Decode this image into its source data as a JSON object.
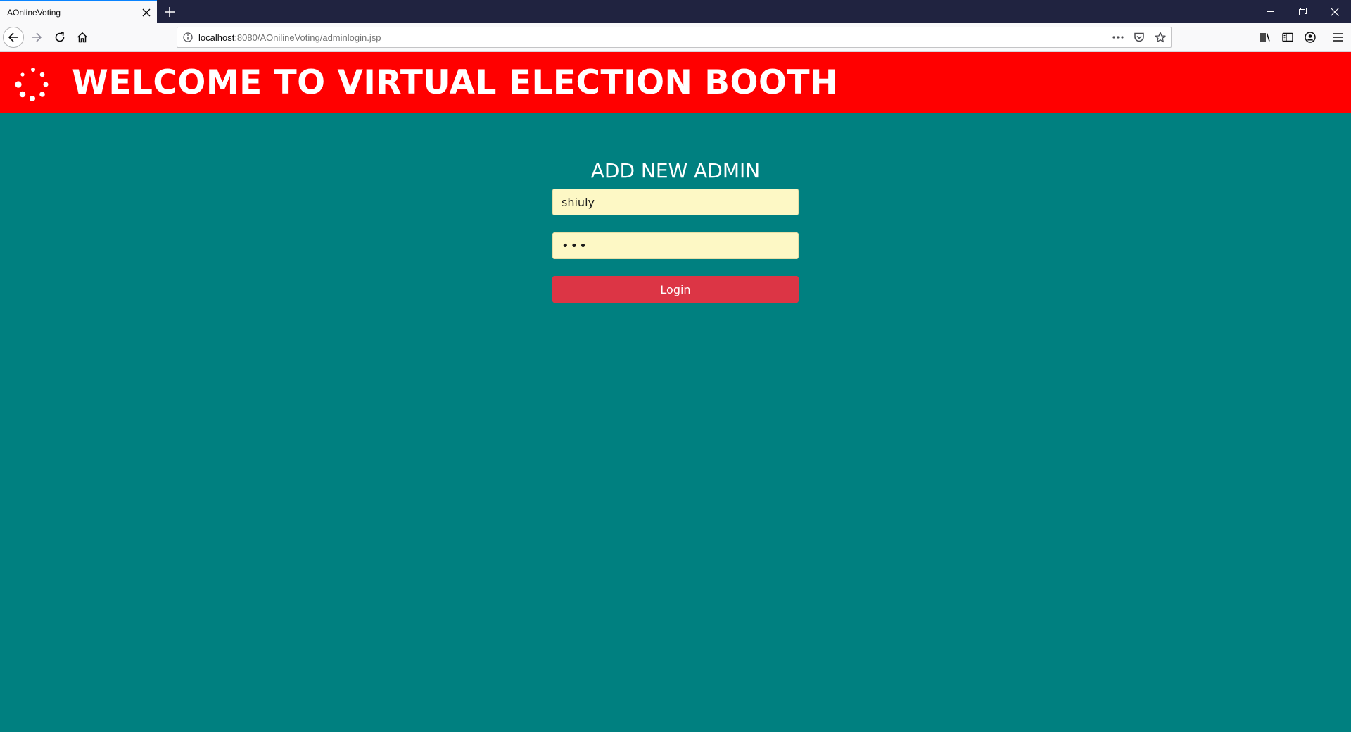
{
  "browser": {
    "tab_title": "AOnlineVoting",
    "url_host": "localhost",
    "url_rest": ":8080/AOnilineVoting/adminlogin.jsp",
    "url_full": "localhost:8080/AOnilineVoting/adminlogin.jsp",
    "icons": {
      "tab_close": "close-icon",
      "new_tab": "plus-icon",
      "minimize": "minimize-icon",
      "restore": "restore-icon",
      "close_window": "close-icon",
      "back": "arrow-left-icon",
      "forward": "arrow-right-icon",
      "reload": "reload-icon",
      "home": "home-icon",
      "page_info": "info-icon",
      "page_actions": "more-horizontal-icon",
      "pocket": "pocket-icon",
      "bookmark": "star-icon",
      "library": "library-icon",
      "sidebar": "sidebar-icon",
      "account": "account-icon",
      "menu": "hamburger-menu-icon"
    }
  },
  "header": {
    "title": "WELCOME TO VIRTUAL ELECTION BOOTH",
    "background_color": "#ff0000",
    "logo_icon": "spinner-logo-icon"
  },
  "form": {
    "title": "ADD NEW ADMIN",
    "username_value": "shiuly",
    "password_value": "abc",
    "login_label": "Login",
    "field_background": "#fdf8c5",
    "button_color": "#dc3545"
  },
  "page": {
    "background_color": "#008080"
  }
}
